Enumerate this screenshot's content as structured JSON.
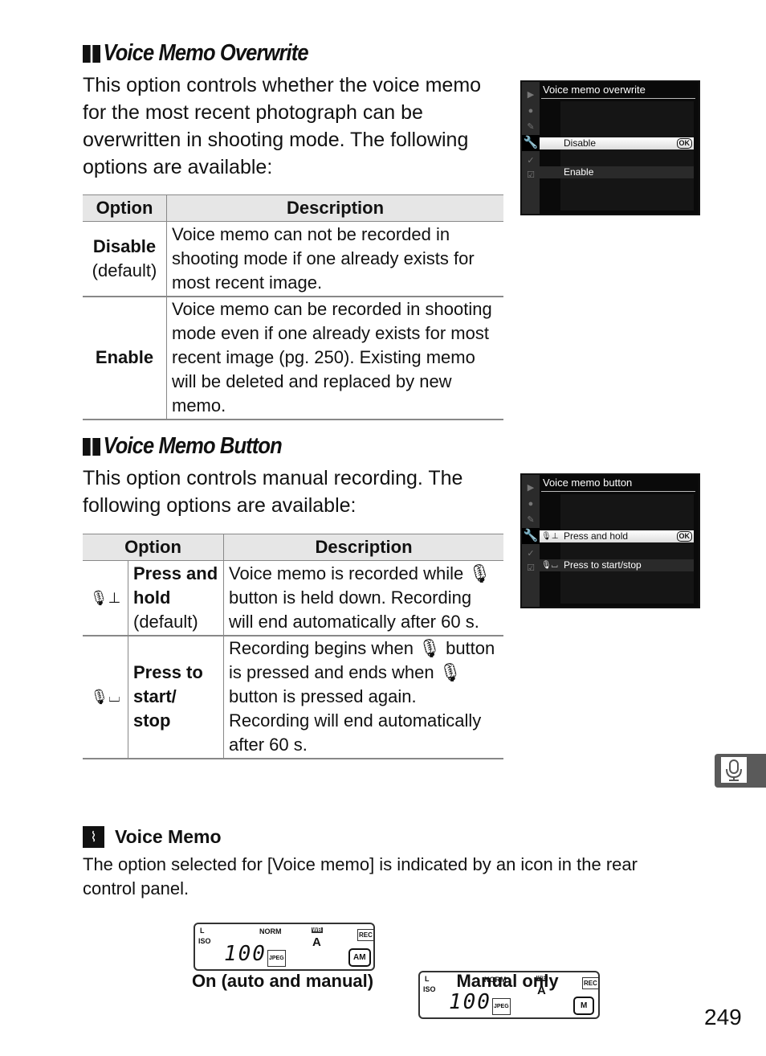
{
  "sections": [
    {
      "title": "Voice Memo Overwrite",
      "intro": "This option controls whether the voice memo for the most recent photograph can be overwritten in shooting mode.  The following options are available:",
      "table": {
        "headers": [
          "Option",
          "Description"
        ],
        "rows": [
          {
            "option": "Disable",
            "note": "(default)",
            "description": "Voice memo can not be recorded in shooting mode if one already exists for most recent image."
          },
          {
            "option": "Enable",
            "note": "",
            "description": "Voice memo can be recorded in shooting mode even if one already exists for most recent image (pg. 250). Existing memo will be deleted and replaced by new memo."
          }
        ]
      },
      "screen": {
        "title": "Voice memo overwrite",
        "items": [
          {
            "label": "Disable",
            "selected": true,
            "icon": ""
          },
          {
            "label": "Enable",
            "selected": false,
            "icon": ""
          }
        ],
        "ok_label": "OK"
      }
    },
    {
      "title": "Voice Memo Button",
      "intro": "This option controls manual recording.  The following options are available:",
      "table": {
        "headers": [
          "Option",
          "Description"
        ],
        "rows": [
          {
            "icon": "mic-press-hold-icon",
            "option": "Press and hold",
            "note": "(default)",
            "description": "Voice memo is recorded while 🎙 button is held down.  Recording will end automatically after 60 s."
          },
          {
            "icon": "mic-press-toggle-icon",
            "option": "Press to start/ stop",
            "note": "",
            "description": "Recording begins when 🎙 button is pressed and ends when 🎙 button is pressed again. Recording will end automatically after 60 s."
          }
        ]
      },
      "screen": {
        "title": "Voice memo button",
        "items": [
          {
            "label": "Press and hold",
            "selected": true,
            "icon": "🎙⊥"
          },
          {
            "label": "Press to start/stop",
            "selected": false,
            "icon": "🎙⌴"
          }
        ],
        "ok_label": "OK"
      }
    }
  ],
  "note": {
    "title": "Voice Memo",
    "icon": "paperclip-icon",
    "body": "The option selected for [Voice memo] is indicated by an icon in the rear control panel."
  },
  "panels": [
    {
      "caption": "On (auto and manual)",
      "indicator": "AM",
      "iso_label": "ISO",
      "iso_value": "100",
      "quality": "NORM",
      "format": "JPEG",
      "wb_label": "WB",
      "wb_value": "A",
      "rec_label": "REC",
      "size_label": "L"
    },
    {
      "caption": "Manual only",
      "indicator": "M",
      "iso_label": "ISO",
      "iso_value": "100",
      "quality": "NORM",
      "format": "JPEG",
      "wb_label": "WB",
      "wb_value": "A",
      "rec_label": "REC",
      "size_label": "L"
    }
  ],
  "side_tab": {
    "icon": "microphone-icon"
  },
  "page_number": "249"
}
